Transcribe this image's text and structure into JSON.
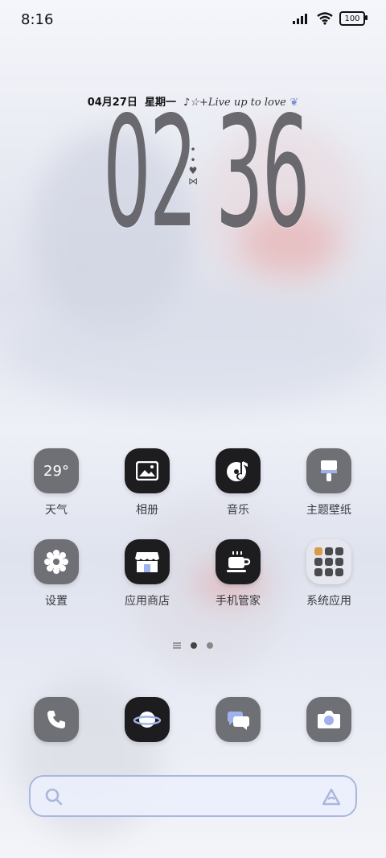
{
  "status_bar": {
    "time": "8:16",
    "battery": "100"
  },
  "widget": {
    "date": "04月27日",
    "weekday": "星期一",
    "motto": "♪☆+Live up to love",
    "hour": "02",
    "minute": "36"
  },
  "apps": [
    {
      "label": "天气",
      "icon": "weather-icon",
      "badge": "29°"
    },
    {
      "label": "相册",
      "icon": "gallery-icon"
    },
    {
      "label": "音乐",
      "icon": "music-icon"
    },
    {
      "label": "主题壁纸",
      "icon": "theme-brush-icon"
    },
    {
      "label": "设置",
      "icon": "gear-icon"
    },
    {
      "label": "应用商店",
      "icon": "store-icon"
    },
    {
      "label": "手机管家",
      "icon": "coffee-cup-icon"
    },
    {
      "label": "系统应用",
      "icon": "folder-icon"
    }
  ],
  "dock": [
    {
      "icon": "phone-icon"
    },
    {
      "icon": "browser-planet-icon"
    },
    {
      "icon": "messages-icon"
    },
    {
      "icon": "camera-icon"
    }
  ],
  "pager": {
    "pages": 2,
    "current": 1
  },
  "search": {
    "placeholder": ""
  }
}
